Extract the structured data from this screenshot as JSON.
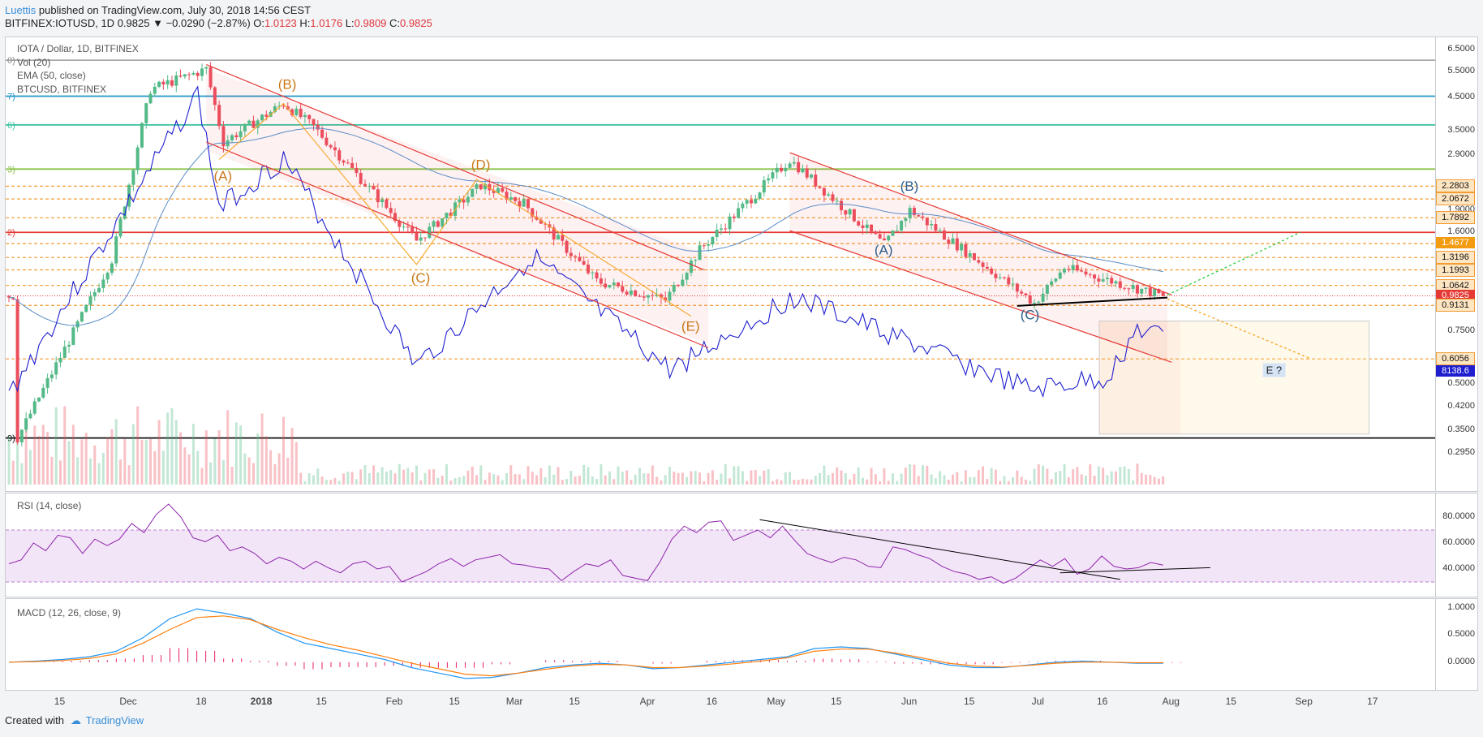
{
  "header": {
    "author": "Luettis",
    "published_text": " published on TradingView.com, July 30, 2018 14:56 CEST",
    "symbol": "BITFINEX:IOTUSD, 1D",
    "last": "0.9825",
    "change": "▼ −0.0290 (−2.87%)",
    "open_label": "O:",
    "open": "1.0123",
    "high_label": "H:",
    "high": "1.0176",
    "low_label": "L:",
    "low": "0.9809",
    "close_label": "C:",
    "close": "0.9825"
  },
  "main_legend": {
    "title": "IOTA / Dollar, 1D, BITFINEX",
    "vol": "Vol (20)",
    "ema": "EMA (50, close)",
    "compare": "BTCUSD, BITFINEX"
  },
  "rsi_legend": "RSI (14, close)",
  "macd_legend": "MACD (12, 26, close, 9)",
  "fib_labels": [
    "0)",
    "7)",
    "6)",
    "3)",
    "2)",
    "9)"
  ],
  "wave_labels_1": [
    "(A)",
    "(B)",
    "(C)",
    "(D)",
    "(E)"
  ],
  "wave_labels_2": [
    "(A)",
    "(B)",
    "(C)"
  ],
  "projection_label": "E ?",
  "price_axis": [
    "6.5000",
    "5.5000",
    "4.5000",
    "3.5000",
    "2.9000",
    "1.9000",
    "1.6000",
    "0.7500",
    "0.5000",
    "0.4200",
    "0.3500",
    "0.2950"
  ],
  "price_badges": [
    {
      "text": "2.2803",
      "style": "orange-outline"
    },
    {
      "text": "2.0672",
      "style": "orange-outline"
    },
    {
      "text": "1.7892",
      "style": "orange-outline"
    },
    {
      "text": "1.4677",
      "style": "orange-fill"
    },
    {
      "text": "1.3196",
      "style": "orange-outline"
    },
    {
      "text": "1.1993",
      "style": "orange-outline"
    },
    {
      "text": "1.0642",
      "style": "orange-outline"
    },
    {
      "text": "0.9825",
      "style": "red-fill"
    },
    {
      "text": "0.9131",
      "style": "orange-outline"
    },
    {
      "text": "0.6056",
      "style": "orange-outline"
    },
    {
      "text": "8138.6",
      "style": "blue-fill"
    }
  ],
  "rsi_axis": [
    "80.0000",
    "60.0000",
    "40.0000"
  ],
  "macd_axis": [
    "1.0000",
    "0.5000",
    "0.0000"
  ],
  "time_axis": [
    "15",
    "Dec",
    "18",
    "2018",
    "15",
    "Feb",
    "15",
    "Mar",
    "15",
    "Apr",
    "16",
    "May",
    "15",
    "Jun",
    "15",
    "Jul",
    "16",
    "Aug",
    "15",
    "Sep",
    "17"
  ],
  "footer": {
    "created": "Created with",
    "brand": "TradingView"
  },
  "colors": {
    "up": "#53b987",
    "down": "#eb4d5c",
    "btc": "#1e1ecf",
    "ema": "#5b8dc9",
    "channel": "#e53935",
    "wave1": "#f5a623",
    "wave2": "#2c5d8a",
    "rsi": "#8e24aa",
    "rsi_band": "#f3e5f8",
    "macd": "#2196f3",
    "signal": "#ff7f0e",
    "hist": "#e91e63"
  },
  "chart_data": {
    "type": "candlestick",
    "title": "IOTA / Dollar, 1D, BITFINEX",
    "y_scale": "log",
    "ylim": [
      0.28,
      6.8
    ],
    "x_range": [
      "2017-11-03",
      "2018-09-28"
    ],
    "summary_last_bar": {
      "date": "2018-07-30",
      "open": 1.0123,
      "high": 1.0176,
      "low": 0.9809,
      "close": 0.9825
    },
    "key_points": [
      {
        "date": "2017-11-05",
        "price": 0.33
      },
      {
        "date": "2017-11-27",
        "price": 1.3
      },
      {
        "date": "2017-12-06",
        "price": 4.8
      },
      {
        "date": "2017-12-19",
        "price": 5.6
      },
      {
        "date": "2017-12-23",
        "price": 3.2
      },
      {
        "date": "2018-01-06",
        "price": 4.3
      },
      {
        "date": "2018-01-13",
        "price": 3.6
      },
      {
        "date": "2018-02-06",
        "price": 1.5
      },
      {
        "date": "2018-02-21",
        "price": 2.3
      },
      {
        "date": "2018-03-03",
        "price": 2.0
      },
      {
        "date": "2018-03-20",
        "price": 1.1
      },
      {
        "date": "2018-04-05",
        "price": 0.95
      },
      {
        "date": "2018-04-13",
        "price": 1.4
      },
      {
        "date": "2018-05-04",
        "price": 2.8
      },
      {
        "date": "2018-05-26",
        "price": 1.45
      },
      {
        "date": "2018-06-01",
        "price": 1.9
      },
      {
        "date": "2018-06-30",
        "price": 0.93
      },
      {
        "date": "2018-07-07",
        "price": 1.22
      },
      {
        "date": "2018-07-30",
        "price": 0.9825
      }
    ],
    "horizontal_levels": [
      6.0,
      4.55,
      3.65,
      2.6,
      1.6,
      0.33,
      2.2803,
      2.0672,
      1.7892,
      1.4677,
      1.3196,
      1.1993,
      1.0642,
      0.9131,
      0.6056
    ],
    "btc_compare_last": 8138.6,
    "rsi": {
      "series": [
        44,
        47,
        60,
        54,
        66,
        64,
        52,
        63,
        58,
        63,
        75,
        68,
        82,
        90,
        80,
        64,
        61,
        66,
        54,
        57,
        52,
        44,
        49,
        46,
        40,
        46,
        41,
        37,
        44,
        46,
        40,
        42,
        30,
        34,
        38,
        44,
        48,
        42,
        47,
        49,
        51,
        44,
        43,
        41,
        40,
        31,
        38,
        44,
        42,
        47,
        35,
        33,
        31,
        45,
        63,
        73,
        68,
        76,
        77,
        62,
        66,
        70,
        64,
        73,
        62,
        52,
        48,
        45,
        49,
        47,
        42,
        41,
        57,
        55,
        51,
        48,
        42,
        38,
        36,
        32,
        34,
        29,
        33,
        40,
        47,
        42,
        48,
        36,
        40,
        50,
        42,
        40,
        41,
        45,
        43
      ],
      "band": [
        30,
        70
      ],
      "ylim": [
        20,
        95
      ]
    },
    "macd": {
      "macd": [
        0,
        0.02,
        0.05,
        0.1,
        0.2,
        0.45,
        0.8,
        0.98,
        0.9,
        0.8,
        0.55,
        0.35,
        0.25,
        0.15,
        0.05,
        -0.1,
        -0.2,
        -0.3,
        -0.28,
        -0.2,
        -0.1,
        -0.05,
        -0.02,
        -0.05,
        -0.12,
        -0.1,
        -0.05,
        0,
        0.05,
        0.1,
        0.25,
        0.28,
        0.25,
        0.15,
        0.05,
        -0.05,
        -0.1,
        -0.1,
        -0.05,
        0,
        0.02,
        0,
        -0.02,
        -0.02
      ],
      "signal": [
        0,
        0.01,
        0.03,
        0.07,
        0.15,
        0.35,
        0.6,
        0.82,
        0.85,
        0.78,
        0.6,
        0.45,
        0.32,
        0.22,
        0.1,
        -0.02,
        -0.12,
        -0.22,
        -0.25,
        -0.2,
        -0.13,
        -0.07,
        -0.04,
        -0.05,
        -0.1,
        -0.1,
        -0.07,
        -0.03,
        0.02,
        0.08,
        0.2,
        0.24,
        0.24,
        0.17,
        0.08,
        -0.02,
        -0.07,
        -0.09,
        -0.06,
        -0.02,
        0,
        0,
        -0.01,
        -0.01
      ],
      "ylim": [
        -0.45,
        1.1
      ]
    }
  }
}
